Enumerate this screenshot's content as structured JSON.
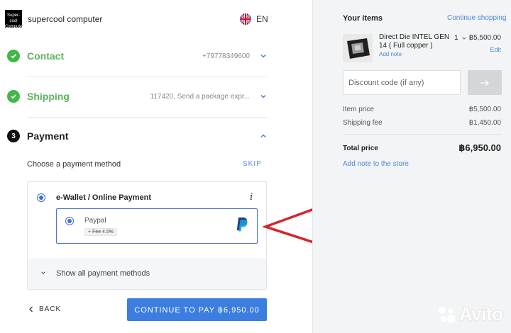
{
  "header": {
    "logo_text": "Supercool Computer",
    "store_name": "supercool computer",
    "language": "EN"
  },
  "steps": {
    "contact": {
      "title": "Contact",
      "summary": "+79778349600"
    },
    "shipping": {
      "title": "Shipping",
      "summary": "117420, Send a package expr..."
    },
    "payment": {
      "number": "3",
      "title": "Payment"
    }
  },
  "payment": {
    "choose_label": "Choose a payment method",
    "skip_label": "SKIP",
    "ewallet_label": "e-Wallet / Online Payment",
    "info_icon": "i",
    "paypal_label": "Paypal",
    "paypal_fee": "+ Fee 4.5%",
    "show_all_label": "Show all payment methods"
  },
  "footer": {
    "back_label": "BACK",
    "continue_label": "CONTINUE TO PAY ฿6,950.00"
  },
  "cart": {
    "title": "Your items",
    "continue_shopping": "Continue shopping",
    "item": {
      "name": "Direct Die INTEL GEN 14 ( Full copper )",
      "add_note": "Add note",
      "quantity": "1",
      "price": "฿5,500.00",
      "edit": "Edit"
    },
    "discount_placeholder": "Discount code (if any)",
    "item_price_label": "Item price",
    "item_price_value": "฿5,500.00",
    "shipping_fee_label": "Shipping fee",
    "shipping_fee_value": "฿1,450.00",
    "total_label": "Total price",
    "total_value": "฿6,950.00",
    "add_note_store": "Add note to the store"
  },
  "watermark": {
    "text": "Avito"
  },
  "colors": {
    "accent_blue": "#3c7ee0",
    "success_green": "#45b649",
    "arrow_red": "#d8232a",
    "paypal_navy": "#253b80",
    "paypal_blue": "#179bd7"
  },
  "icons": [
    "uk-flag-icon",
    "check-icon",
    "chevron-down-icon",
    "chevron-up-icon",
    "info-icon",
    "paypal-logo-icon",
    "chevron-left-icon",
    "arrow-right-icon",
    "red-arrow-annotation"
  ]
}
